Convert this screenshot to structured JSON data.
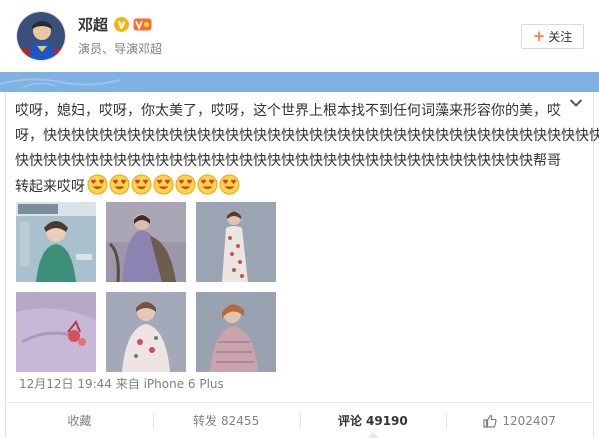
{
  "header": {
    "user_name": "邓超",
    "user_desc": "演员、导演邓超",
    "verified_icon": "verified-v-icon",
    "level_icon": "member-level-icon",
    "follow_label": "关注",
    "accent_color": "#ff8140"
  },
  "post": {
    "lines": [
      "哎呀，媳妇，哎呀，你太美了，哎呀，这个世界上根本找不到任何词藻来形容你的美，哎",
      "呀，快快快快快快快快快快快快快快快快快快快快快快快快快快快快快快快快快快快快快快快快",
      "快快快快快快快快快快快快快快快快快快快快快快快快快快快快快快快快快快快快快帮哥",
      "转起来哎呀"
    ],
    "emoji_icon": "heart-eyes-emoji-icon",
    "emoji_count": 7,
    "photos": [
      "photo-magazine-cover",
      "photo-purple-dress-chair",
      "photo-floral-cheongsam",
      "photo-lilac-gown-closeup",
      "photo-embroidered-top",
      "photo-lace-dress"
    ],
    "meta": "12月12日 19:44 来自 iPhone 6 Plus"
  },
  "actions": {
    "favorite_label": "收藏",
    "repost_label": "转发",
    "repost_count": "82455",
    "comment_label": "评论",
    "comment_count": "49190",
    "like_count": "1202407"
  }
}
